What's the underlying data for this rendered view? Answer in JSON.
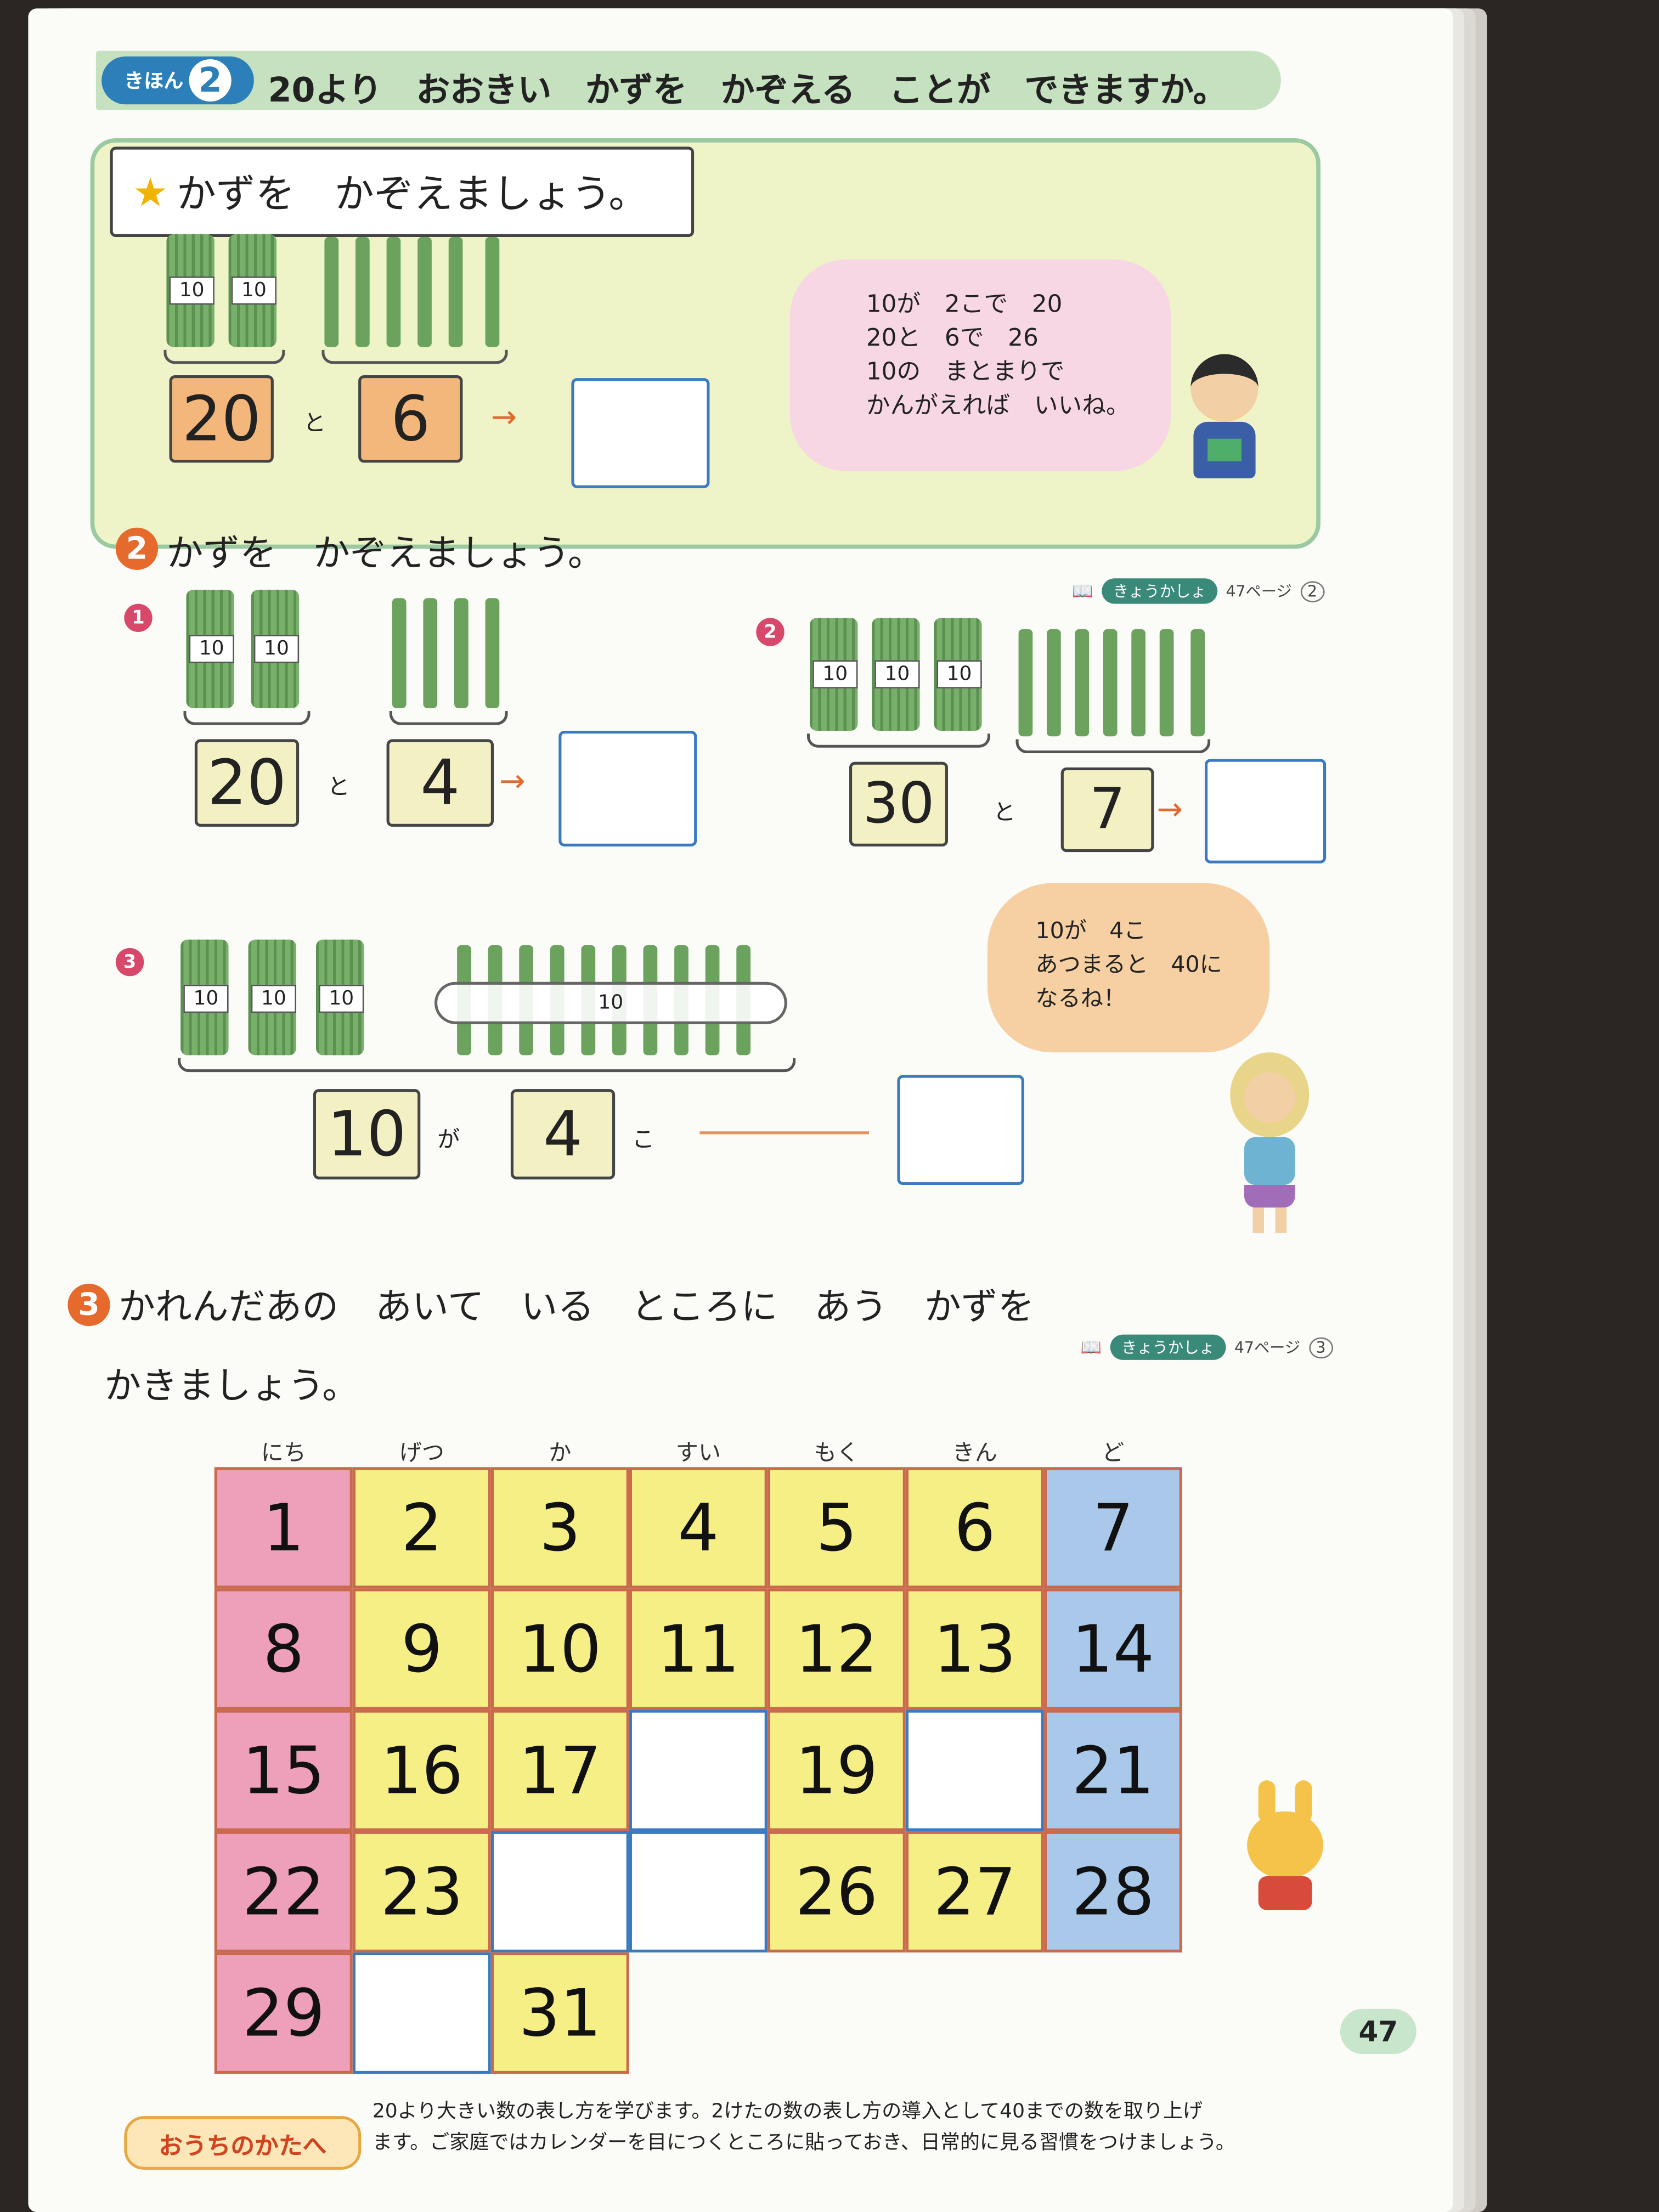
{
  "header": {
    "kihon_label": "きほん",
    "kihon_number": "2",
    "title": "20より　おおきい　かずを　かぞえる　ことが　できますか。"
  },
  "example": {
    "prompt": "かずを　かぞえましょう。",
    "tag1": "10",
    "tag2": "10",
    "left_value": "20",
    "conj": "と",
    "right_value": "6",
    "bubble_lines": [
      "10が　2こで　20",
      "20と　6で　26",
      "10の　まとまりで",
      "かんがえれば　いいね。"
    ]
  },
  "section2": {
    "number": "2",
    "prompt": "かずを　かぞえましょう。",
    "ref_label": "きょうかしょ",
    "ref_page": "47ページ",
    "ref_num": "2",
    "q1": {
      "num": "1",
      "tags": [
        "10",
        "10"
      ],
      "left": "20",
      "conj": "と",
      "right": "4"
    },
    "q2": {
      "num": "2",
      "tags": [
        "10",
        "10",
        "10"
      ],
      "left": "30",
      "conj": "と",
      "right": "7"
    },
    "q3": {
      "num": "3",
      "tags": [
        "10",
        "10",
        "10"
      ],
      "ring_label": "10",
      "left": "10",
      "ga": "が",
      "right": "4",
      "ko": "こ"
    },
    "bubble_lines": [
      "10が　4こ",
      "あつまると　40に",
      "なるね！"
    ]
  },
  "section3": {
    "number": "3",
    "prompt_line1": "かれんだあの　あいて　いる　ところに　あう　かずを",
    "prompt_line2": "かきましょう。",
    "ref_label": "きょうかしょ",
    "ref_page": "47ページ",
    "ref_num": "3",
    "days": [
      "にち",
      "げつ",
      "か",
      "すい",
      "もく",
      "きん",
      "ど"
    ],
    "row1": [
      "1",
      "2",
      "3",
      "4",
      "5",
      "6",
      "7"
    ],
    "row2": [
      "8",
      "9",
      "10",
      "11",
      "12",
      "13",
      "14"
    ],
    "row3": [
      "15",
      "16",
      "17",
      "",
      "19",
      "",
      "21"
    ],
    "row4": [
      "22",
      "23",
      "",
      "",
      "26",
      "27",
      "28"
    ],
    "row5": [
      "29",
      "",
      "31"
    ]
  },
  "footer": {
    "badge": "おうちのかたへ",
    "note_line1": "20より大きい数の表し方を学びます。2けたの数の表し方の導入として40までの数を取り上げ",
    "note_line2": "ます。ご家庭ではカレンダーを目につくところに貼っておき、日常的に見る習慣をつけましょう。",
    "page_number": "47"
  },
  "colors": {
    "sunday": "#ee9fb9",
    "weekday": "#f5ef86",
    "saturday": "#a9c8ea",
    "answer_box": "#3a7ac0",
    "accent": "#e56a2c"
  }
}
